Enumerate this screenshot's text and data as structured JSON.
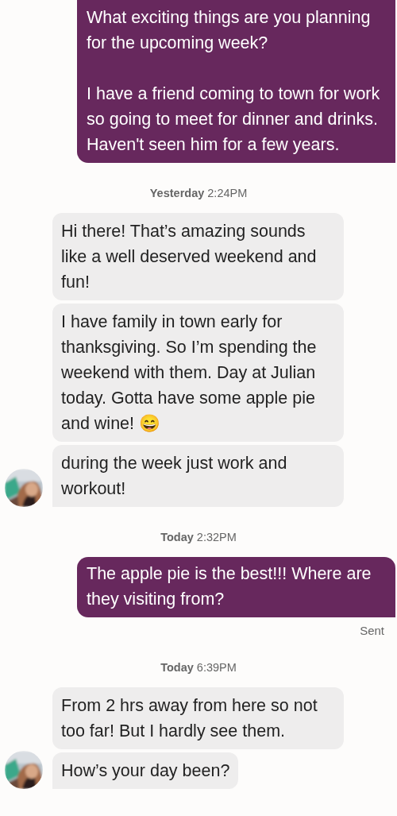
{
  "thread": [
    {
      "kind": "sent",
      "messages": [
        "What exciting things are you planning for the upcoming week?\n\nI have a friend coming to town for work so going to meet for dinner and drinks. Haven't seen him for a few years."
      ]
    },
    {
      "kind": "timestamp",
      "day": "Yesterday",
      "time": "2:24PM"
    },
    {
      "kind": "received",
      "messages": [
        "Hi there! That’s amazing sounds like a well deserved weekend and fun!",
        "I have family in town early for thanksgiving. So I’m spending the weekend with them. Day at Julian today. Gotta have some apple pie and wine! 😄",
        "during the week just work and workout!"
      ]
    },
    {
      "kind": "timestamp",
      "day": "Today",
      "time": "2:32PM"
    },
    {
      "kind": "sent",
      "messages": [
        "The apple pie is the best!!!  Where are they visiting from?"
      ],
      "status": "Sent"
    },
    {
      "kind": "timestamp",
      "day": "Today",
      "time": "6:39PM"
    },
    {
      "kind": "received",
      "messages": [
        "From 2 hrs away from here so not too far! But I hardly see them.",
        "How’s your day been?"
      ]
    }
  ]
}
